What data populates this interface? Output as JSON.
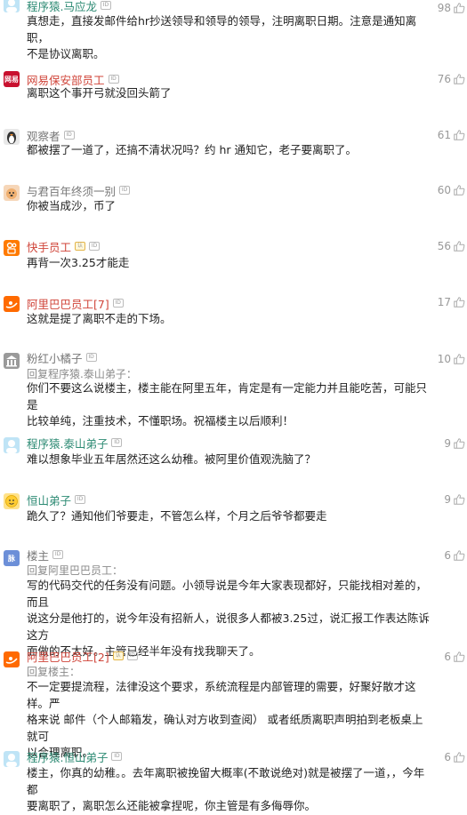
{
  "comments": [
    {
      "user": "程序猿.马应龙",
      "body": [
        "真想走，直接发邮件给hr抄送领导和领导的领导，注明离职日期。注意是通知离职，",
        "不是协议离职。"
      ],
      "likes": "98"
    },
    {
      "user": "网易保安部员工",
      "body": [
        "离职这个事开弓就没回头箭了"
      ],
      "likes": "76"
    },
    {
      "user": "观察者",
      "body": [
        "都被摆了一道了，还搞不清状况吗？约 hr 通知它，老子要离职了。"
      ],
      "likes": "61"
    },
    {
      "user": "与君百年终须一别",
      "body": [
        "你被当成沙，币了"
      ],
      "likes": "60"
    },
    {
      "user": "快手员工",
      "body": [
        "再背一次3.25才能走"
      ],
      "likes": "56"
    },
    {
      "user": "阿里巴巴员工[7]",
      "body": [
        "这就是提了离职不走的下场。"
      ],
      "likes": "17"
    },
    {
      "user": "粉红小橘子",
      "reply": "回复程序猿.泰山弟子：",
      "body": [
        "你们不要这么说楼主，楼主能在阿里五年，肯定是有一定能力并且能吃苦，可能只是",
        "比较单纯，注重技术，不懂职场。祝福楼主以后顺利！"
      ],
      "likes": "10"
    },
    {
      "user": "程序猿.泰山弟子",
      "body": [
        "难以想象毕业五年居然还这么幼稚。被阿里价值观洗脑了？"
      ],
      "likes": "9"
    },
    {
      "user": "恒山弟子",
      "body": [
        "跪久了？通知他们爷要走，不管怎么样，个月之后爷爷都要走"
      ],
      "likes": "9"
    },
    {
      "user": "楼主",
      "reply": "回复阿里巴巴员工：",
      "body": [
        "写的代码交代的任务没有问题。小领导说是今年大家表现都好，只能找相对差的，而且",
        "说这分是他打的，说今年没有招新人，说很多人都被3.25过，说汇报工作表达陈诉这方",
        "面做的不太好。主管已经半年没有找我聊天了。"
      ],
      "likes": "6"
    },
    {
      "user": "阿里巴巴员工[2]",
      "reply": "回复楼主：",
      "body": [
        "不一定要提流程，法律没这个要求，系统流程是内部管理的需要，好聚好散才这样。严",
        "格来说 邮件（个人邮箱发，确认对方收到查阅） 或者纸质离职声明拍到老板桌上就可",
        "以合理离职。"
      ],
      "likes": "6"
    },
    {
      "user": "程序猿.恒山弟子",
      "body": [
        "楼主，你真的幼稚。。去年离职被挽留大概率(不敢说绝对)就是被摆了一道，，今年都",
        "要离职了，离职怎么还能被拿捏呢，你主管是有多侮辱你。"
      ],
      "likes": "6"
    }
  ],
  "badge_id_label": "ID",
  "badge_verified_label": "认",
  "avatar_labels": [
    "网易",
    "1",
    "脉"
  ],
  "colors": {
    "accent_red": "#d0453a",
    "teal": "#2c8a73",
    "gray_text": "#8a8a8a"
  }
}
